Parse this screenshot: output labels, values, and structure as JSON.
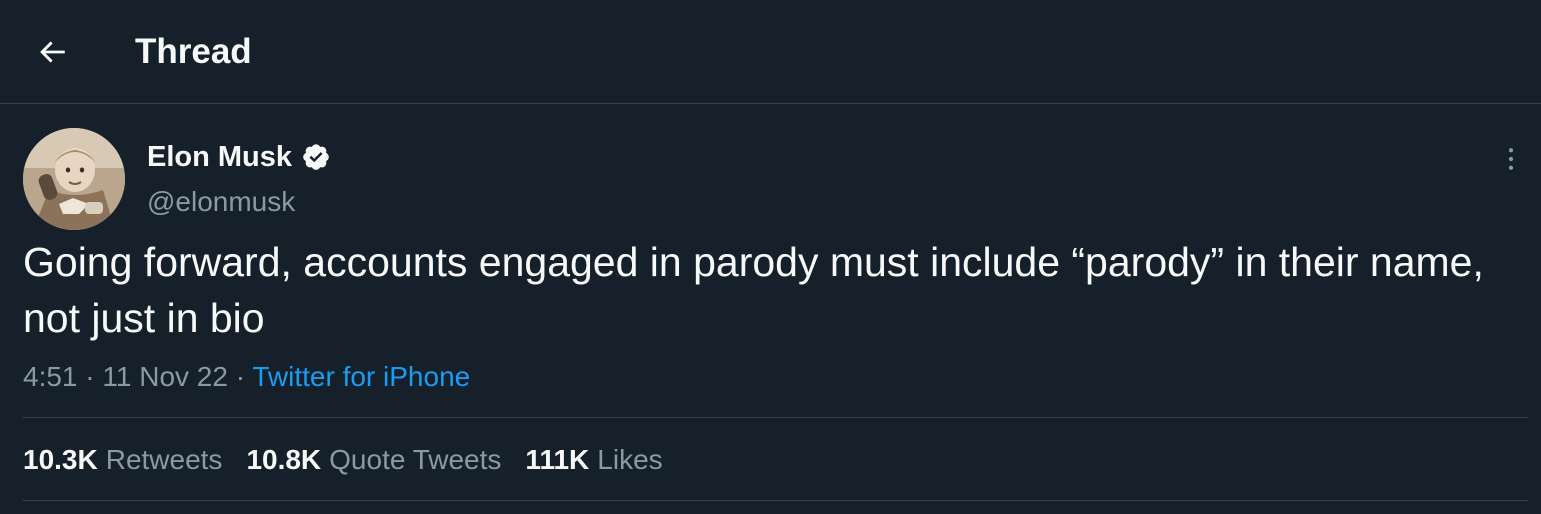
{
  "header": {
    "title": "Thread",
    "back_icon": "arrow-left-icon"
  },
  "tweet": {
    "author": {
      "name": "Elon Musk",
      "handle": "@elonmusk",
      "verified": true,
      "verified_icon": "verified-badge-icon"
    },
    "more_icon": "more-vertical-icon",
    "text": "Going forward, accounts engaged in parody must include “parody” in their name, not just in bio",
    "time": "4:51",
    "separator": "·",
    "date": "11 Nov 22",
    "source": "Twitter for iPhone",
    "stats": [
      {
        "value": "10.3K",
        "label": "Retweets"
      },
      {
        "value": "10.8K",
        "label": "Quote Tweets"
      },
      {
        "value": "111K",
        "label": "Likes"
      }
    ]
  },
  "colors": {
    "background": "#15202b",
    "text_primary": "#f7f9f9",
    "text_secondary": "#8b98a5",
    "accent": "#1d9bf0",
    "divider": "#38444d"
  }
}
